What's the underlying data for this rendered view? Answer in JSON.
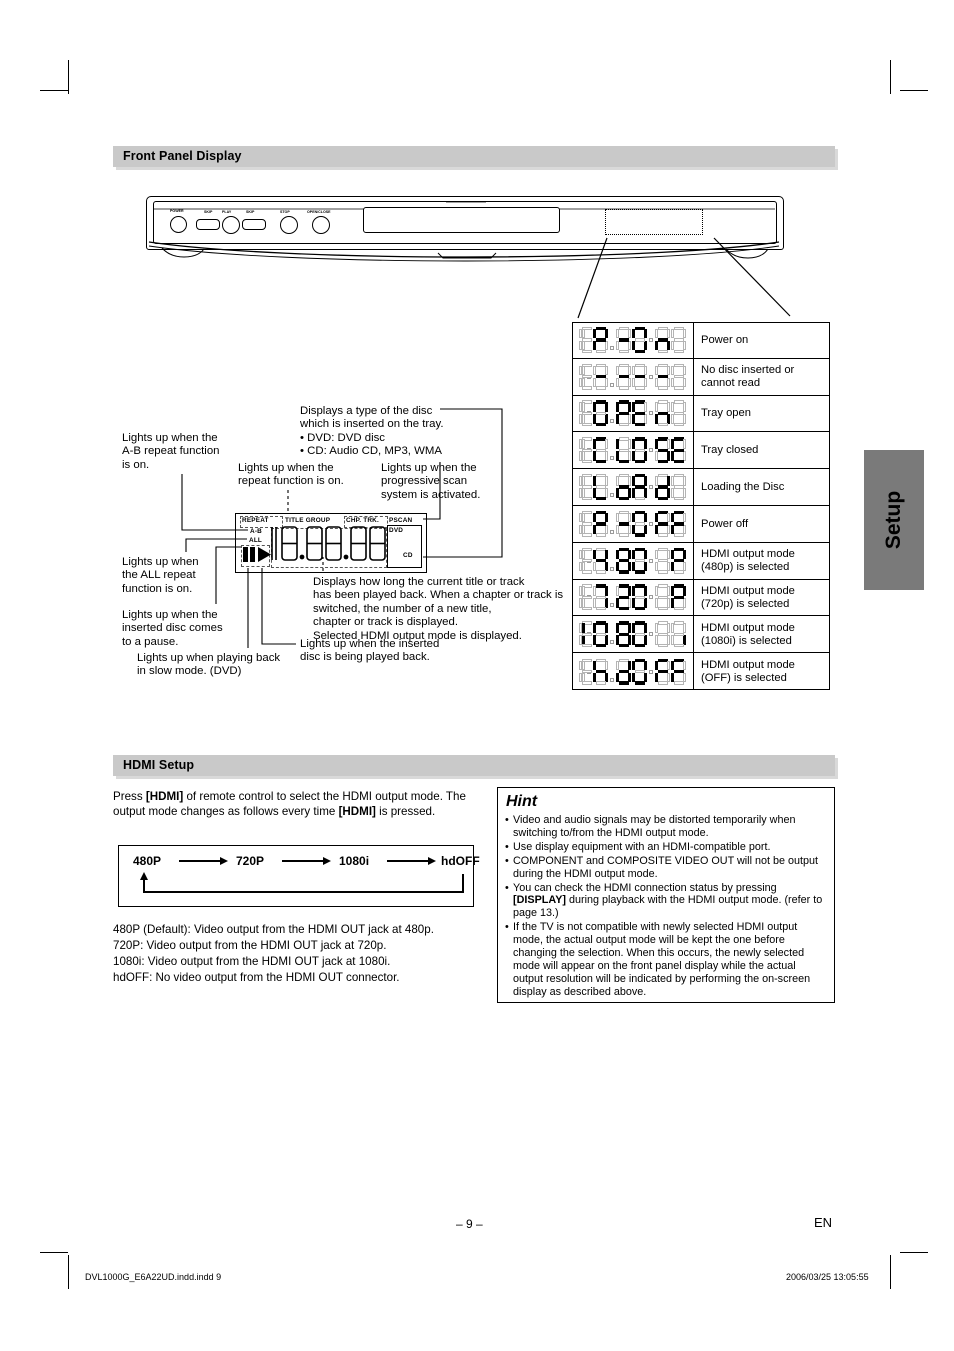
{
  "page": {
    "number": "– 9 –",
    "lang_mark": "EN",
    "footer_file": "DVL1000G_E6A22UD.indd.indd   9",
    "footer_date": "2006/03/25   13:05:55",
    "side_tab": "Setup"
  },
  "sections": {
    "front_panel": {
      "title": "Front Panel Display"
    },
    "hdmi_setup": {
      "title": "HDMI Setup"
    }
  },
  "front_panel_unit": {
    "buttons": [
      {
        "name": "power",
        "label": "POWER"
      },
      {
        "name": "skip-back",
        "label": "SKIP"
      },
      {
        "name": "play",
        "label": "PLAY"
      },
      {
        "name": "skip-forward",
        "label": "SKIP"
      },
      {
        "name": "stop",
        "label": "STOP"
      },
      {
        "name": "open-close",
        "label": "OPEN/CLOSE"
      }
    ]
  },
  "vfd_diagram": {
    "indicators": {
      "repeat": "REPEAT",
      "title_group": "TITLE GROUP",
      "chp_trk": "CHP. TRK.",
      "pscan": "PSCAN",
      "ab": "A-B",
      "all": "ALL",
      "dvd": "DVD",
      "cd": "CD"
    },
    "callouts": [
      {
        "id": "ab-repeat",
        "text": "Lights up when the\nA-B repeat function\nis on."
      },
      {
        "id": "repeat",
        "text": "Lights up when the\nrepeat function is on."
      },
      {
        "id": "disc-type",
        "text": "Displays a type of the disc\nwhich is inserted on the tray.\n• DVD: DVD disc\n• CD: Audio CD, MP3, WMA"
      },
      {
        "id": "pscan",
        "text": "Lights up when the\nprogressive scan\nsystem is activated."
      },
      {
        "id": "all-repeat",
        "text": "Lights up when\nthe ALL repeat\nfunction is on."
      },
      {
        "id": "pause",
        "text": "Lights up when the\ninserted disc comes\nto a pause."
      },
      {
        "id": "slow",
        "text": "Lights up when playing back\nin slow mode. (DVD)"
      },
      {
        "id": "play",
        "text": "Lights up when the inserted\ndisc is being played back."
      },
      {
        "id": "time",
        "text": "Displays how long the current title or track\nhas been played back. When a chapter or track is\nswitched, the number of a new title,\nchapter or track is displayed.\nSelected HDMI output mode is displayed."
      }
    ]
  },
  "display_table": {
    "rows": [
      {
        "code": "P-On",
        "segments": [
          "off",
          "P",
          "-",
          "O",
          "n",
          "off"
        ],
        "description": "Power on"
      },
      {
        "code": "----",
        "segments": [
          "off",
          "-",
          "-",
          "-",
          "-",
          "off"
        ],
        "description": "No disc inserted or\ncannot read"
      },
      {
        "code": "OPEn",
        "segments": [
          "off",
          "O",
          "P",
          "E",
          "n",
          "off"
        ],
        "description": "Tray open"
      },
      {
        "code": "CLOSE",
        "segments": [
          "off",
          "C",
          "L",
          "O",
          "S",
          "E"
        ],
        "description": "Tray closed"
      },
      {
        "code": "Load",
        "segments": [
          "off",
          "L",
          "o",
          "A",
          "d",
          "off"
        ],
        "description": "Loading the Disc"
      },
      {
        "code": "P-OFF",
        "segments": [
          "off",
          "P",
          "-",
          "O",
          "F",
          "F"
        ],
        "description": "Power off"
      },
      {
        "code": "480P",
        "segments": [
          "off",
          "4",
          "8",
          "0",
          "off",
          "P"
        ],
        "description": "HDMI output mode\n(480p) is selected"
      },
      {
        "code": "720P",
        "segments": [
          "off",
          "7",
          "2",
          "0",
          "off",
          "P"
        ],
        "description": "HDMI output mode\n(720p) is selected"
      },
      {
        "code": "1080i",
        "segments": [
          "1",
          "0",
          "8",
          "0",
          "off",
          "i"
        ],
        "description": "HDMI output mode\n(1080i) is selected"
      },
      {
        "code": "hdOFF",
        "segments": [
          "off",
          "h",
          "d",
          "O",
          "F",
          "F"
        ],
        "description": "HDMI output mode\n(OFF) is selected"
      }
    ]
  },
  "hdmi_setup": {
    "intro_parts": [
      "Press ",
      "[HDMI]",
      " of remote control to select the HDMI output\nmode. The output mode changes as follows every time\n",
      "[HDMI]",
      " is pressed."
    ],
    "flow": [
      "480P",
      "720P",
      "1080i",
      "hdOFF"
    ],
    "descriptions": [
      "480P (Default): Video output from the HDMI OUT jack at 480p.",
      "720P: Video output from the HDMI OUT jack at 720p.",
      "1080i: Video output from the HDMI OUT jack at 1080i.",
      "hdOFF: No video output from the HDMI OUT connector."
    ]
  },
  "hint": {
    "title": "Hint",
    "items": [
      "Video and audio signals may be distorted temporarily when switching to/from the HDMI output mode.",
      "Use display equipment with an HDMI-compatible port.",
      "COMPONENT and COMPOSITE VIDEO OUT will not be output during the HDMI output mode.",
      "You can check the HDMI connection status by pressing [DISPLAY] during playback with the HDMI output mode. (refer to page 13.)",
      "If the TV is not compatible with newly selected HDMI output mode, the actual output mode will be kept the one before changing the selection. When this occurs, the newly selected mode will appear on the front panel display while the actual output resolution will be indicated by performing the on-screen display as described above."
    ],
    "bold_terms": [
      "[DISPLAY]"
    ]
  },
  "colors": {
    "section_bar": "#c9c9c9",
    "section_shadow": "#d9d9d9",
    "side_tab": "#7a7a7a",
    "ink": "#000000",
    "segment_off": "#b4b4b4"
  }
}
